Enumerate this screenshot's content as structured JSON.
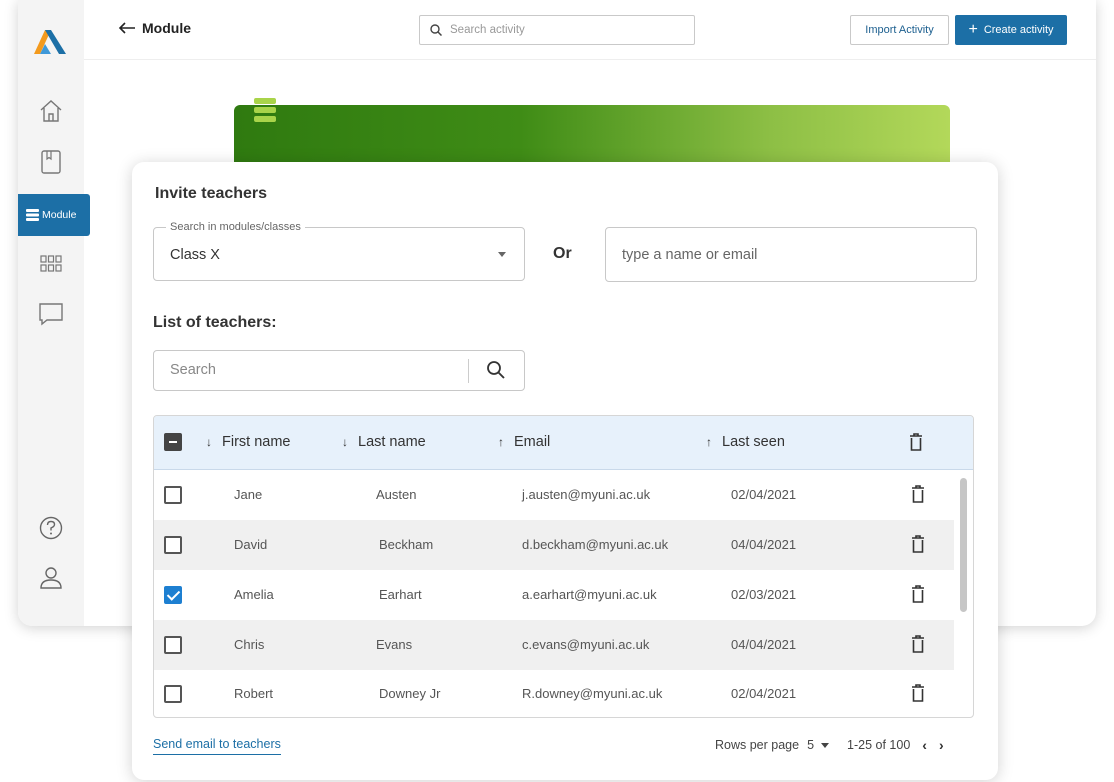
{
  "nav": {
    "module_label": "Module"
  },
  "topbar": {
    "back_label": "Module",
    "search_placeholder": "Search activity",
    "import_label": "Import Activity",
    "create_label": "Create activity"
  },
  "invite": {
    "title": "Invite teachers",
    "select_legend": "Search in modules/classes",
    "select_value": "Class X",
    "or_label": "Or",
    "name_placeholder": "type a name or email"
  },
  "list": {
    "title": "List of teachers:",
    "search_placeholder": "Search",
    "columns": [
      {
        "label": "First name",
        "arrow": "↓"
      },
      {
        "label": "Last name",
        "arrow": "↓"
      },
      {
        "label": "Email",
        "arrow": "↑"
      },
      {
        "label": "Last seen",
        "arrow": "↑"
      }
    ],
    "rows": [
      {
        "first": "Jane",
        "last": "Austen",
        "email": "j.austen@myuni.ac.uk",
        "seen": "02/04/2021",
        "checked": false
      },
      {
        "first": "David",
        "last": "Beckham",
        "email": "d.beckham@myuni.ac.uk",
        "seen": "04/04/2021",
        "checked": false
      },
      {
        "first": "Amelia",
        "last": "Earhart",
        "email": "a.earhart@myuni.ac.uk",
        "seen": "02/03/2021",
        "checked": true
      },
      {
        "first": "Chris",
        "last": "Evans",
        "email": "c.evans@myuni.ac.uk",
        "seen": "04/04/2021",
        "checked": false
      },
      {
        "first": "Robert",
        "last": "Downey Jr",
        "email": "R.downey@myuni.ac.uk",
        "seen": "02/04/2021",
        "checked": false
      }
    ]
  },
  "footer": {
    "send_label": "Send email to teachers",
    "rows_per_page_label": "Rows per page",
    "rows_per_page_value": "5",
    "range_label": "1-25 of 100"
  },
  "colors": {
    "accent": "#1c6fa6",
    "header_bg": "#e7f1fb",
    "banner_start": "#2f7a10",
    "banner_end": "#b3d85a"
  },
  "icons": [
    "logo",
    "home-icon",
    "book-icon",
    "module-icon",
    "grid-icon",
    "chat-icon",
    "help-icon",
    "user-icon",
    "back-arrow-icon",
    "search-icon",
    "plus-icon",
    "trash-icon",
    "chevron-left-icon",
    "chevron-right-icon"
  ]
}
